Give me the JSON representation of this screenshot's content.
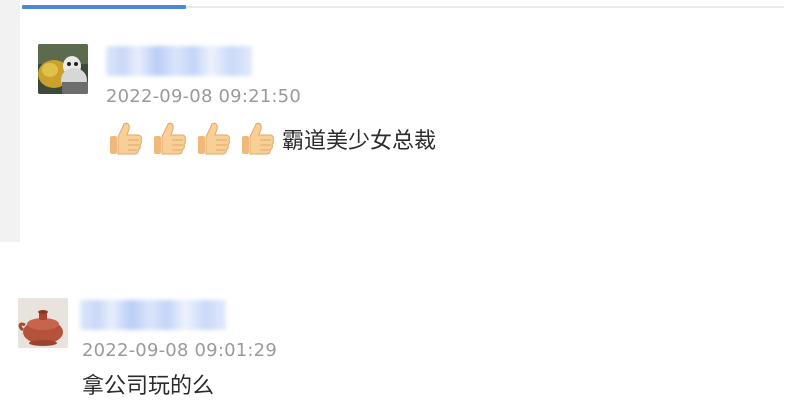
{
  "tabs": {
    "active_index": 0
  },
  "comments": [
    {
      "username": "",
      "timestamp": "2022-09-08 09:21:50",
      "emojis": [
        "thumbs-up-icon",
        "thumbs-up-icon",
        "thumbs-up-icon",
        "thumbs-up-icon"
      ],
      "text": "霸道美少女总裁"
    },
    {
      "username": "",
      "timestamp": "2022-09-08 09:01:29",
      "emojis": [],
      "text": "拿公司玩的么"
    }
  ],
  "colors": {
    "accent": "#4a86d9",
    "timestamp": "#9a9a9a",
    "text": "#2b2b2b",
    "username_blur": "#c9d8f8"
  }
}
